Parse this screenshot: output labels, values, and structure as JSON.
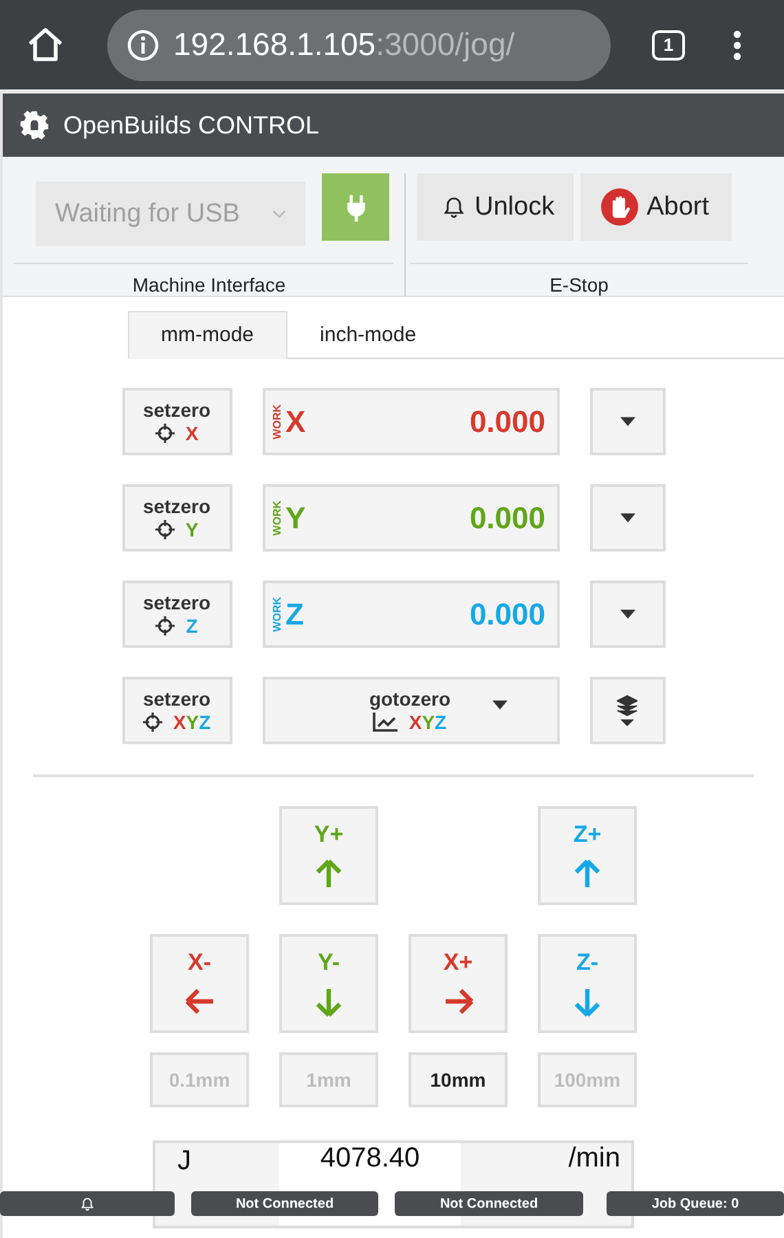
{
  "browser": {
    "url_host": "192.168.1.105",
    "url_path": ":3000/jog/",
    "tab_count": "1"
  },
  "app_title": "OpenBuilds CONTROL",
  "connection": {
    "port_placeholder": "Waiting for USB",
    "section_label": "Machine Interface"
  },
  "estop": {
    "unlock": "Unlock",
    "abort": "Abort",
    "section_label": "E-Stop"
  },
  "tabs": [
    {
      "label": "mm-mode",
      "selected": true
    },
    {
      "label": "inch-mode",
      "selected": false
    }
  ],
  "axes": [
    {
      "letter": "X",
      "color": "#d63a2c",
      "work_label": "WORK",
      "value": "0.000",
      "setzero": "setzero",
      "setzero_letter": "X"
    },
    {
      "letter": "Y",
      "color": "#5fa619",
      "work_label": "WORK",
      "value": "0.000",
      "setzero": "setzero",
      "setzero_letter": "Y"
    },
    {
      "letter": "Z",
      "color": "#17a8e6",
      "work_label": "WORK",
      "value": "0.000",
      "setzero": "setzero",
      "setzero_letter": "Z"
    }
  ],
  "setzero_all": {
    "label": "setzero",
    "letters": [
      {
        "letter": "X",
        "color": "#d63a2c"
      },
      {
        "letter": "Y",
        "color": "#5fa619"
      },
      {
        "letter": "Z",
        "color": "#17a8e6"
      }
    ]
  },
  "gotozero": {
    "label": "gotozero",
    "letters": [
      {
        "letter": "X",
        "color": "#d63a2c"
      },
      {
        "letter": "Y",
        "color": "#5fa619"
      },
      {
        "letter": "Z",
        "color": "#17a8e6"
      }
    ]
  },
  "jog_buttons": [
    {
      "kind": "spacer"
    },
    {
      "kind": "up",
      "label": "Y+",
      "color": "#5fa619"
    },
    {
      "kind": "spacer"
    },
    {
      "kind": "up",
      "label": "Z+",
      "color": "#17a8e6"
    },
    {
      "kind": "left",
      "label": "X-",
      "color": "#d63a2c"
    },
    {
      "kind": "down",
      "label": "Y-",
      "color": "#5fa619"
    },
    {
      "kind": "right",
      "label": "X+",
      "color": "#d63a2c"
    },
    {
      "kind": "down",
      "label": "Z-",
      "color": "#17a8e6"
    }
  ],
  "steps": [
    {
      "label": "0.1mm",
      "selected": false
    },
    {
      "label": "1mm",
      "selected": false
    },
    {
      "label": "10mm",
      "selected": true
    },
    {
      "label": "100mm",
      "selected": false
    }
  ],
  "feed": {
    "label": "J",
    "value": "4078.40",
    "unit": "/min"
  },
  "status_bar": [
    {
      "kind": "bell"
    },
    {
      "kind": "text",
      "text": "Not Connected"
    },
    {
      "kind": "text",
      "text": "Not Connected"
    },
    {
      "kind": "text",
      "text": "Job Queue: 0"
    }
  ]
}
